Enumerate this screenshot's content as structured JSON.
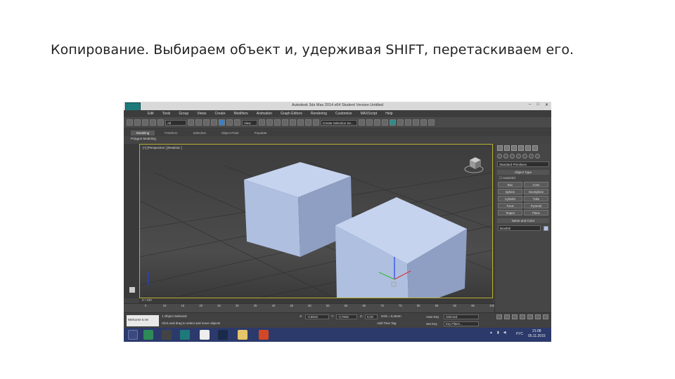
{
  "slide": {
    "title": "Копирование. Выбираем  объект и, удерживая SHIFT, перетаскиваем его."
  },
  "window": {
    "title": "Autodesk 3ds Max  2014 x64    Student Version    Untitled"
  },
  "menu": {
    "items": [
      "Edit",
      "Tools",
      "Group",
      "Views",
      "Create",
      "Modifiers",
      "Animation",
      "Graph Editors",
      "Rendering",
      "Customize",
      "MAXScript",
      "Help"
    ]
  },
  "toolbar": {
    "filter_select": "All",
    "view_select": "View",
    "named_selection": "Create Selection Se..."
  },
  "ribbon": {
    "tabs": [
      "Modeling",
      "Freeform",
      "Selection",
      "Object Paint",
      "Populate"
    ],
    "active_tab": "Modeling",
    "panel_label": "Polygon Modeling"
  },
  "viewport": {
    "label": "[+] [Perspective ] [Realistic ]"
  },
  "command_panel": {
    "category_dropdown": "Standard Primitives",
    "object_type_header": "Object Type",
    "autogrid_label": "AutoGrid",
    "buttons": [
      "Box",
      "Cone",
      "Sphere",
      "GeoSphere",
      "Cylinder",
      "Tube",
      "Torus",
      "Pyramid",
      "Teapot",
      "Plane"
    ],
    "name_color_header": "Name and Color",
    "object_name": "Box002",
    "object_color": "#aec3e8"
  },
  "timeline": {
    "time_readout": "0 / 100",
    "ticks": [
      "0",
      "10",
      "15",
      "20",
      "25",
      "30",
      "35",
      "40",
      "45",
      "50",
      "55",
      "60",
      "65",
      "70",
      "75",
      "80",
      "85",
      "90",
      "95",
      "100"
    ]
  },
  "status": {
    "maxscript_label": "Welcome to M",
    "selection_status": "1 Object Selected",
    "prompt": "Click and drag to select and move objects",
    "x_label": "X:",
    "x_value": "-0,952m",
    "y_label": "Y:",
    "y_value": "-0,766m",
    "z_label": "Z:",
    "z_value": "0,0m",
    "grid": "Grid = 0,254m",
    "add_time_tag": "Add Time Tag",
    "auto_key": "Auto Key",
    "selected_dropdown": "Selected",
    "set_key": "Set Key",
    "key_filters": "Key Filters..."
  },
  "taskbar": {
    "tray_lang": "РУС",
    "clock_time": "21:08",
    "clock_date": "05.11.2015"
  },
  "colors": {
    "box_top": "#c6d3ee",
    "box_left": "#aebfe0",
    "box_right": "#8e9fc3",
    "viewport_border": "#b8b030",
    "taskbar": "#2b3a6b"
  }
}
